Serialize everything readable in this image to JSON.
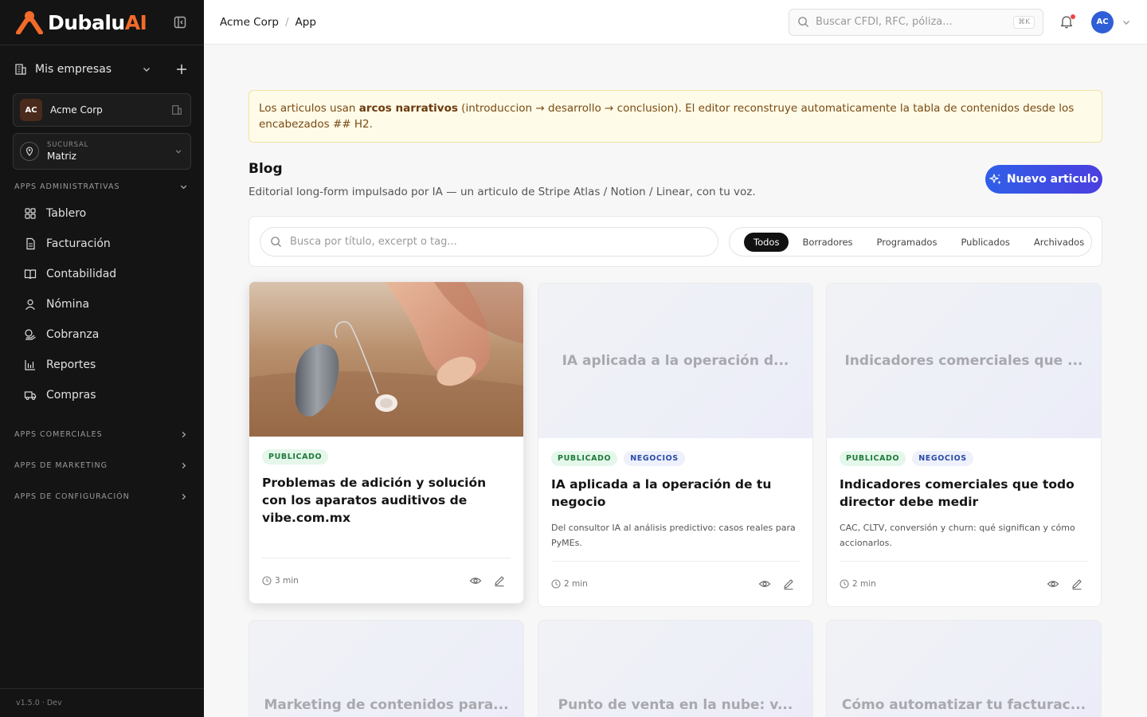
{
  "brand": {
    "name_main": "Dubalu",
    "name_accent": "AI",
    "accent_color": "#f26b2a"
  },
  "sidebar": {
    "companies_label": "Mis empresas",
    "company": {
      "initials": "AC",
      "name": "Acme Corp"
    },
    "branch": {
      "label": "SUCURSAL",
      "value": "Matriz"
    },
    "groups": [
      {
        "label": "APPS ADMINISTRATIVAS",
        "expanded": true
      },
      {
        "label": "APPS COMERCIALES",
        "expanded": false
      },
      {
        "label": "APPS DE MARKETING",
        "expanded": false
      },
      {
        "label": "APPS DE CONFIGURACIÓN",
        "expanded": false
      }
    ],
    "items": [
      {
        "label": "Tablero",
        "icon": "grid-icon"
      },
      {
        "label": "Facturación",
        "icon": "document-icon"
      },
      {
        "label": "Contabilidad",
        "icon": "book-icon"
      },
      {
        "label": "Nómina",
        "icon": "user-icon"
      },
      {
        "label": "Cobranza",
        "icon": "coins-icon"
      },
      {
        "label": "Reportes",
        "icon": "bar-chart-icon"
      },
      {
        "label": "Compras",
        "icon": "truck-icon"
      }
    ],
    "version": "v1.5.0 · Dev"
  },
  "topbar": {
    "breadcrumb": [
      "Acme Corp",
      "/",
      "App"
    ],
    "search_placeholder": "Buscar CFDI, RFC, póliza...",
    "shortcut": "⌘K",
    "user_initials": "AC",
    "has_notification": true
  },
  "notice": {
    "part1": "Los articulos usan ",
    "bold": "arcos narrativos",
    "part2": " (introduccion → desarrollo → conclusion). El editor reconstruye automaticamente la tabla de contenidos desde los encabezados ## H2."
  },
  "page": {
    "title": "Blog",
    "subtitle": "Editorial long-form impulsado por IA — un articulo de Stripe Atlas / Notion / Linear, con tu voz.",
    "new_button": "Nuevo articulo"
  },
  "filters": {
    "search_placeholder": "Busca por título, excerpt o tag...",
    "tabs": [
      "Todos",
      "Borradores",
      "Programados",
      "Publicados",
      "Archivados"
    ],
    "active_tab": "Todos"
  },
  "cards": [
    {
      "cover_type": "photo",
      "cover_title": "",
      "badges": [
        "PUBLICADO"
      ],
      "title": "Problemas de adición y solución con los aparatos auditivos de vibe.com.mx",
      "excerpt": "",
      "read_time": "3 min"
    },
    {
      "cover_type": "placeholder",
      "cover_title": "IA aplicada a la operación d...",
      "badges": [
        "PUBLICADO",
        "NEGOCIOS"
      ],
      "title": "IA aplicada a la operación de tu negocio",
      "excerpt": "Del consultor IA al análisis predictivo: casos reales para PyMEs.",
      "read_time": "2 min"
    },
    {
      "cover_type": "placeholder",
      "cover_title": "Indicadores comerciales que ...",
      "badges": [
        "PUBLICADO",
        "NEGOCIOS"
      ],
      "title": "Indicadores comerciales que todo director debe medir",
      "excerpt": "CAC, CLTV, conversión y churn: qué significan y cómo accionarlos.",
      "read_time": "2 min"
    },
    {
      "cover_type": "placeholder",
      "cover_title": "Marketing de contenidos para..."
    },
    {
      "cover_type": "placeholder",
      "cover_title": "Punto de venta en la nube: v..."
    },
    {
      "cover_type": "placeholder",
      "cover_title": "Cómo automatizar tu facturac..."
    }
  ]
}
